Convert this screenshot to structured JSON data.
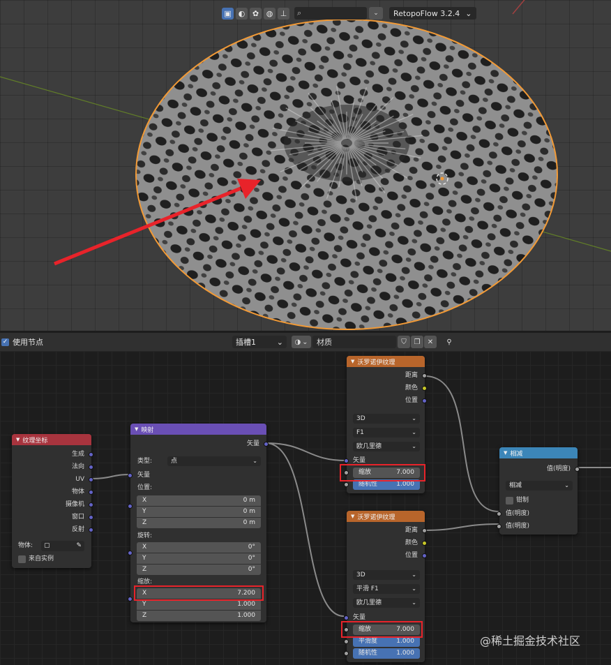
{
  "viewport": {
    "toolbar": {
      "icons": [
        "solid-shading-icon",
        "material-shading-icon",
        "rendered-shading-icon",
        "globe-icon",
        "gizmo-icon"
      ],
      "search_placeholder": "",
      "addon_label": "RetopoFlow 3.2.4"
    },
    "colors": {
      "selection_outline": "#f29a36",
      "arrow": "#e8232a",
      "x_axis": "#a04040",
      "y_axis": "#6b8e23"
    }
  },
  "editor_header": {
    "use_nodes_label": "使用节点",
    "slot_label": "插槽1",
    "material_name": "材质"
  },
  "nodes": {
    "tex_coord": {
      "title": "纹理坐标",
      "outputs": [
        "生成",
        "法向",
        "UV",
        "物体",
        "摄像机",
        "窗口",
        "反射"
      ],
      "object_label": "物体:",
      "from_instancer_label": "来自实例"
    },
    "mapping": {
      "title": "映射",
      "output_vector": "矢量",
      "type_label": "类型:",
      "type_value": "点",
      "input_vector": "矢量",
      "location_label": "位置:",
      "location": [
        {
          "axis": "X",
          "value": "0 m"
        },
        {
          "axis": "Y",
          "value": "0 m"
        },
        {
          "axis": "Z",
          "value": "0 m"
        }
      ],
      "rotation_label": "旋转:",
      "rotation": [
        {
          "axis": "X",
          "value": "0°"
        },
        {
          "axis": "Y",
          "value": "0°"
        },
        {
          "axis": "Z",
          "value": "0°"
        }
      ],
      "scale_label": "缩放:",
      "scale": [
        {
          "axis": "X",
          "value": "7.200"
        },
        {
          "axis": "Y",
          "value": "1.000"
        },
        {
          "axis": "Z",
          "value": "1.000"
        }
      ]
    },
    "voronoi1": {
      "title": "沃罗诺伊纹理",
      "outputs": [
        "距离",
        "颜色",
        "位置"
      ],
      "dimension": "3D",
      "feature": "F1",
      "metric": "欧几里德",
      "vector_label": "矢量",
      "scale_label": "缩放",
      "scale_value": "7.000",
      "randomness_label": "随机性",
      "randomness_value": "1.000"
    },
    "voronoi2": {
      "title": "沃罗诺伊纹理",
      "outputs": [
        "距离",
        "颜色",
        "位置"
      ],
      "dimension": "3D",
      "feature": "平滑 F1",
      "metric": "欧几里德",
      "vector_label": "矢量",
      "scale_label": "缩放",
      "scale_value": "7.000",
      "smoothness_label": "平滑度",
      "smoothness_value": "1.000",
      "randomness_label": "随机性",
      "randomness_value": "1.000"
    },
    "subtract": {
      "title": "相减",
      "output_label": "值(明度)",
      "operation": "相减",
      "clamp_label": "钳制",
      "input1_label": "值(明度)",
      "input2_label": "值(明度)"
    }
  },
  "colors": {
    "header_tex": "#a8343e",
    "header_vector": "#6a4fb5",
    "header_texture": "#b8652b",
    "header_converter": "#3c86b8",
    "highlight": "#e8232a",
    "accent": "#4772b3"
  },
  "watermark": "@稀土掘金技术社区"
}
